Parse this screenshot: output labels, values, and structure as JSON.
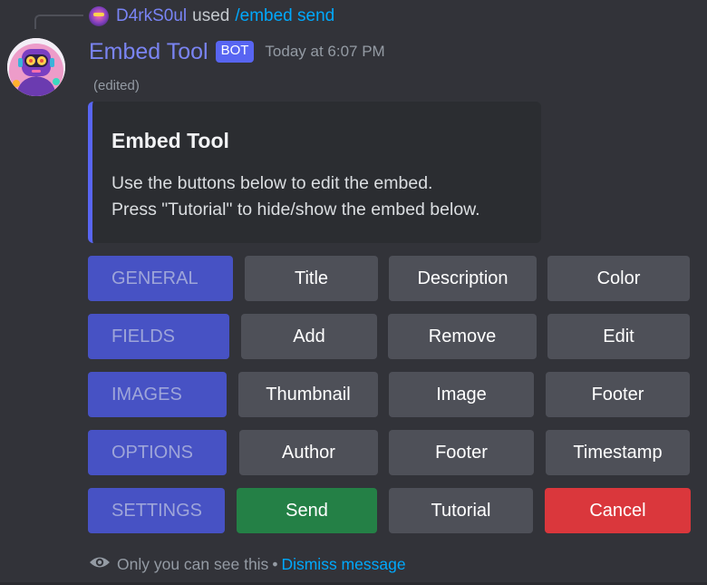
{
  "reply": {
    "user": "D4rkS0ul",
    "used": "used",
    "command": "/embed send"
  },
  "author": {
    "name": "Embed Tool",
    "tag": "BOT",
    "timestamp": "Today at 6:07 PM",
    "edited": "(edited)"
  },
  "embed": {
    "accent_color": "#5865f2",
    "title": "Embed Tool",
    "description": "Use the buttons below to edit the embed.\nPress \"Tutorial\" to hide/show the embed below."
  },
  "rows": [
    {
      "category": "GENERAL",
      "buttons": [
        "Title",
        "Description",
        "Color"
      ]
    },
    {
      "category": "FIELDS",
      "buttons": [
        "Add",
        "Remove",
        "Edit"
      ]
    },
    {
      "category": "IMAGES",
      "buttons": [
        "Thumbnail",
        "Image",
        "Footer"
      ]
    },
    {
      "category": "OPTIONS",
      "buttons": [
        "Author",
        "Footer",
        "Timestamp"
      ]
    },
    {
      "category": "SETTINGS",
      "buttons": [
        "Send",
        "Tutorial",
        "Cancel"
      ]
    }
  ],
  "ephemeral": {
    "icon": "eye-icon",
    "text": "Only you can see this",
    "separator": "•",
    "dismiss": "Dismiss message"
  },
  "colors": {
    "blurple": "#5865f2",
    "category_button": "#4752c4",
    "secondary_button": "#4e5058",
    "success_button": "#248046",
    "danger_button": "#da373c",
    "link": "#00a8fc"
  }
}
